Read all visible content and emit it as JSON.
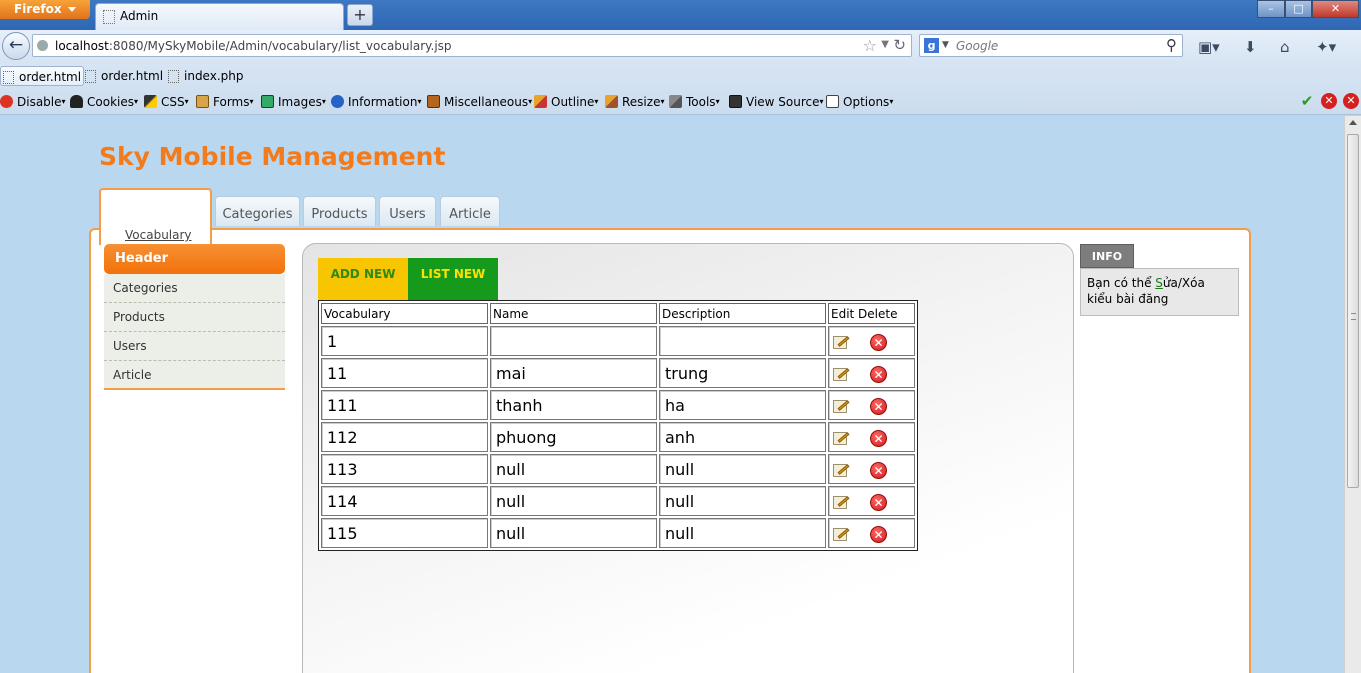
{
  "browser": {
    "app_button": "Firefox",
    "tab_title": "Admin",
    "new_tab_symbol": "+",
    "url_host": "localhost",
    "url_rest": ":8080/MySkyMobile/Admin/vocabulary/list_vocabulary.jsp",
    "search_placeholder": "Google",
    "search_engine_letter": "g"
  },
  "bookmarks": [
    "order.html",
    "order.html",
    "index.php"
  ],
  "webdev_toolbar": [
    "Disable",
    "Cookies",
    "CSS",
    "Forms",
    "Images",
    "Information",
    "Miscellaneous",
    "Outline",
    "Resize",
    "Tools",
    "View Source",
    "Options"
  ],
  "site": {
    "title": "Sky Mobile Management",
    "tabs": [
      "Vocabulary",
      "Categories",
      "Products",
      "Users",
      "Article"
    ]
  },
  "sidebar": {
    "header": "Header",
    "items": [
      "Categories",
      "Products",
      "Users",
      "Article"
    ]
  },
  "actions": {
    "add_new": "ADD NEW",
    "list_new": "LIST NEW"
  },
  "table": {
    "headers": [
      "Vocabulary",
      "Name",
      "Description",
      "Edit Delete"
    ],
    "rows": [
      {
        "vocabulary": "1",
        "name": "",
        "description": ""
      },
      {
        "vocabulary": "11",
        "name": "mai",
        "description": "trung"
      },
      {
        "vocabulary": "111",
        "name": "thanh",
        "description": "ha"
      },
      {
        "vocabulary": "112",
        "name": "phuong",
        "description": "anh"
      },
      {
        "vocabulary": "113",
        "name": "null",
        "description": "null"
      },
      {
        "vocabulary": "114",
        "name": "null",
        "description": "null"
      },
      {
        "vocabulary": "115",
        "name": "null",
        "description": "null"
      }
    ]
  },
  "info": {
    "tab": "INFO",
    "text_before": "Bạn có thể ",
    "text_underlined": "S",
    "text_after": "ửa/Xóa kiểu bài đăng"
  }
}
